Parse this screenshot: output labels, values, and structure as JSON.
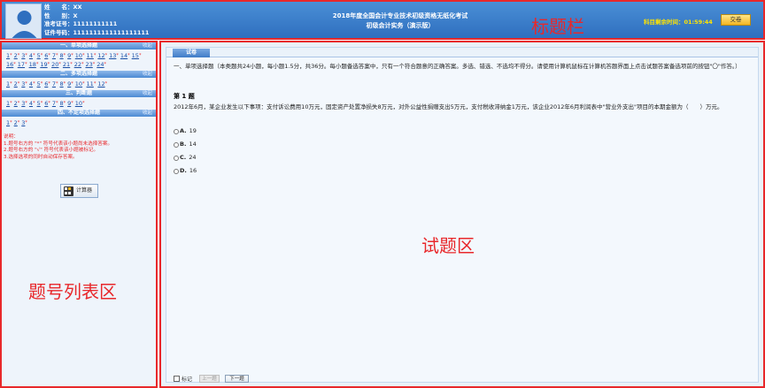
{
  "header": {
    "name_row": "姓　　名：XX",
    "gender_row": "性　　别：X",
    "admission_row": "准考证号：11111111111",
    "id_row": "证件号码：1111111111111111111",
    "exam_title_line1": "2018年度全国会计专业技术初级资格无纸化考试",
    "exam_title_line2": "初级会计实务（演示版）",
    "region_label": "标题栏",
    "time_left": "科目剩余时间：01:59:44",
    "submit_label": "交卷"
  },
  "left_panel": {
    "region_label": "题号列表区",
    "sections": [
      {
        "title": "一、单项选择题",
        "collapse": "收起",
        "numbers": [
          "1",
          "2",
          "3",
          "4",
          "5",
          "6",
          "7",
          "8",
          "9",
          "10",
          "11",
          "12",
          "13",
          "14",
          "15",
          "16",
          "17",
          "18",
          "19",
          "20",
          "21",
          "22",
          "23",
          "24"
        ]
      },
      {
        "title": "二、多项选择题",
        "collapse": "收起",
        "numbers": [
          "1",
          "2",
          "3",
          "4",
          "5",
          "6",
          "7",
          "8",
          "9",
          "10",
          "11",
          "12"
        ]
      },
      {
        "title": "三、判断题",
        "collapse": "收起",
        "numbers": [
          "1",
          "2",
          "3",
          "4",
          "5",
          "6",
          "7",
          "8",
          "9",
          "10"
        ]
      },
      {
        "title": "四、不定项选择题",
        "collapse": "收起",
        "numbers": [
          "1",
          "2",
          "3"
        ]
      }
    ],
    "unanswered_mark": "*",
    "notes": {
      "title": "说明：",
      "line1": "1.题号右方的 \"*\" 符号代表该小题尚未选择答案。",
      "line2": "2.题号右方的 \"√\" 符号代表该小题被标记。",
      "line3": "3.选择选项的同时自动保存答案。"
    },
    "calculator_label": "计算器"
  },
  "question_area": {
    "tab_label": "试卷",
    "instructions": "一、单项选择题（本类题共24小题，每小题1.5分，共36分。每小题备选答案中，只有一个符合题意的正确答案。多选、错选、不选均不得分。请使用计算机鼠标在计算机答题界面上点击试题答案备选项前的按钮\"〇\"作答。）",
    "question_title": "第 1 题",
    "question_text": "2012年6月，某企业发生以下事项：支付诉讼费用10万元，固定资产处置净损失8万元，对外公益性捐赠支出5万元，支付税收滞纳金1万元，该企业2012年6月利润表中\"营业外支出\"项目的本期金额为（　　）万元。",
    "options": [
      {
        "letter": "A.",
        "text": "19"
      },
      {
        "letter": "B.",
        "text": "14"
      },
      {
        "letter": "C.",
        "text": "24"
      },
      {
        "letter": "D.",
        "text": "16"
      }
    ],
    "region_label": "试题区",
    "mark_label": "标记",
    "prev_label": "上一题",
    "next_label": "下一题"
  },
  "colors": {
    "header_blue": "#2f6fbf",
    "annotation_red": "#e8282b",
    "time_yellow": "#ffe400"
  }
}
